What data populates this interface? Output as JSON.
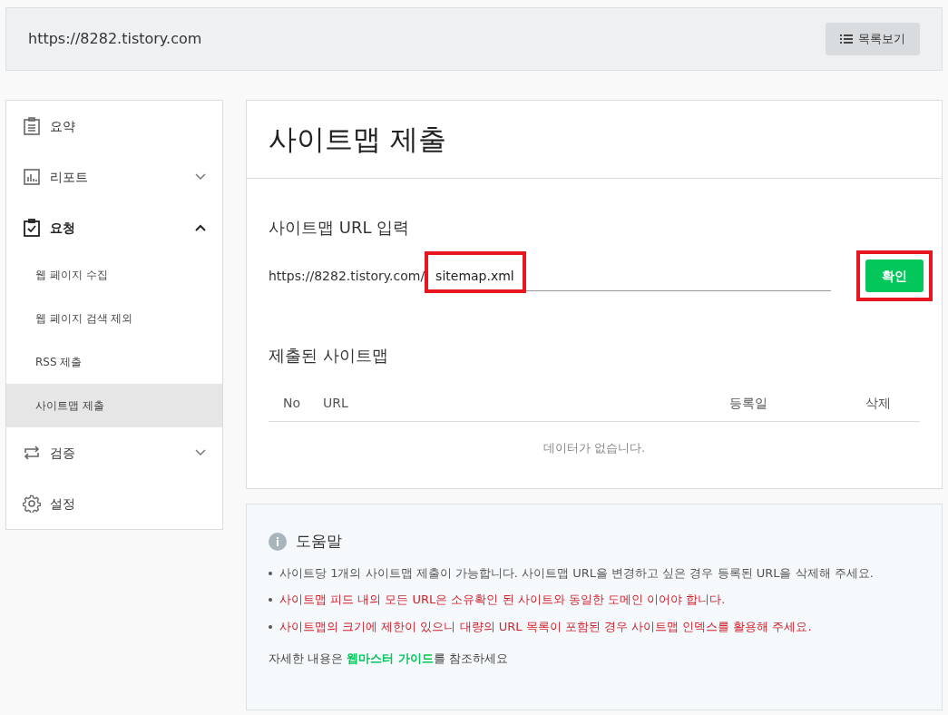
{
  "header": {
    "site_url": "https://8282.tistory.com",
    "list_button": "목록보기"
  },
  "sidebar": {
    "items": [
      {
        "kind": "summary",
        "label": "요약",
        "active": false
      },
      {
        "kind": "report",
        "label": "리포트",
        "active": false,
        "expanded": false
      },
      {
        "kind": "request",
        "label": "요청",
        "active": true,
        "expanded": true,
        "children": [
          {
            "label": "웹 페이지 수집",
            "selected": false
          },
          {
            "label": "웹 페이지 검색 제외",
            "selected": false
          },
          {
            "label": "RSS 제출",
            "selected": false
          },
          {
            "label": "사이트맵 제출",
            "selected": true
          }
        ]
      },
      {
        "kind": "verify",
        "label": "검증",
        "active": false,
        "expanded": false
      },
      {
        "kind": "settings",
        "label": "설정",
        "active": false
      }
    ]
  },
  "main": {
    "title": "사이트맵 제출",
    "url_section": {
      "heading": "사이트맵 URL 입력",
      "prefix": "https://8282.tistory.com/",
      "value": "sitemap.xml",
      "input_highlighted": true,
      "confirm_button": "확인",
      "button_highlighted": true
    },
    "submitted": {
      "heading": "제출된 사이트맵",
      "columns": [
        "No",
        "URL",
        "등록일",
        "삭제"
      ],
      "empty_message": "데이터가 없습니다."
    }
  },
  "help": {
    "title": "도움말",
    "bullets": [
      {
        "text": "사이트당 1개의 사이트맵 제출이 가능합니다. 사이트맵 URL을 변경하고 싶은 경우 등록된 URL을 삭제해 주세요.",
        "kind": "normal"
      },
      {
        "text": "사이트맵 피드 내의 모든 URL은 소유확인 된 사이트와 동일한 도메인 이어야 합니다.",
        "kind": "warning"
      },
      {
        "text": "사이트맵의 크기에 제한이 있으니 대량의 URL 목록이 포함된 경우 사이트맵 인덱스를 활용해 주세요.",
        "kind": "warning"
      }
    ],
    "footer_before": "자세한 내용은",
    "footer_link": "웹마스터 가이드",
    "footer_after": "를 참조하세요"
  }
}
